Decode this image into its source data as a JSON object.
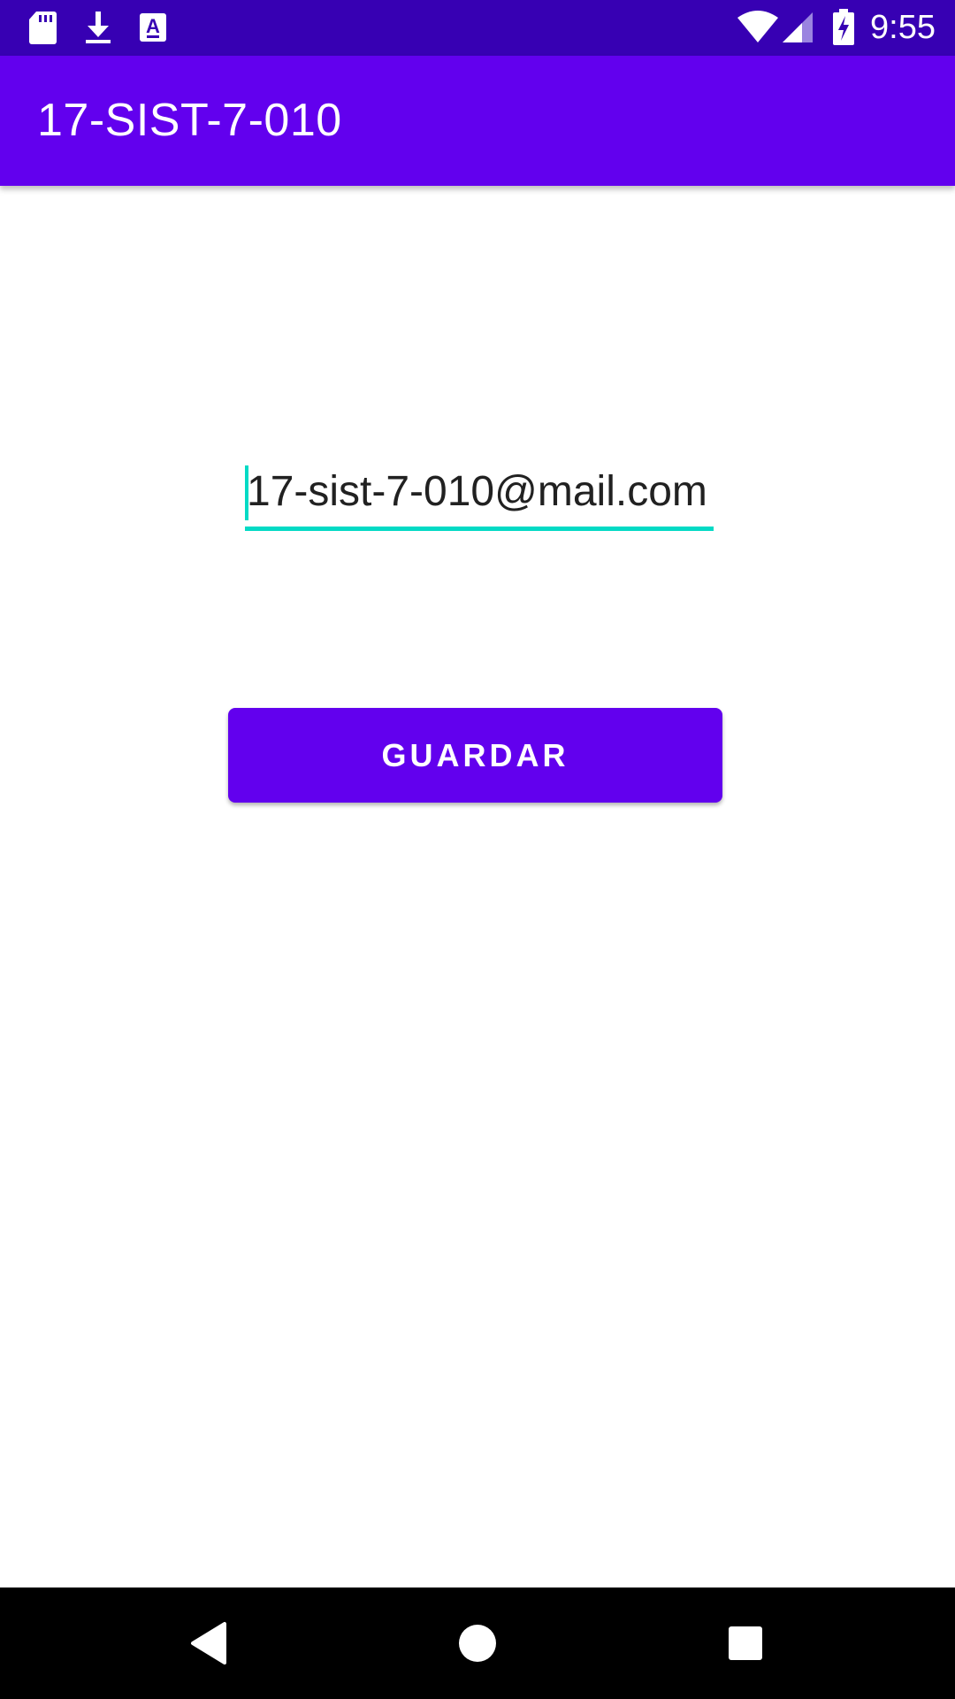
{
  "status_bar": {
    "time": "9:55",
    "icons": [
      "sd-card-icon",
      "download-icon",
      "keyboard-a-icon",
      "wifi-icon",
      "signal-icon",
      "battery-charging-icon"
    ],
    "color": "#3700b3"
  },
  "app_bar": {
    "title": "17-SIST-7-010",
    "color": "#6200ee"
  },
  "form": {
    "email_value": "17-sist-7-010@mail.com",
    "underline_color": "#03dac5",
    "save_label": "GUARDAR"
  },
  "nav_bar": {
    "buttons": [
      "back-icon",
      "home-icon",
      "recents-icon"
    ]
  }
}
